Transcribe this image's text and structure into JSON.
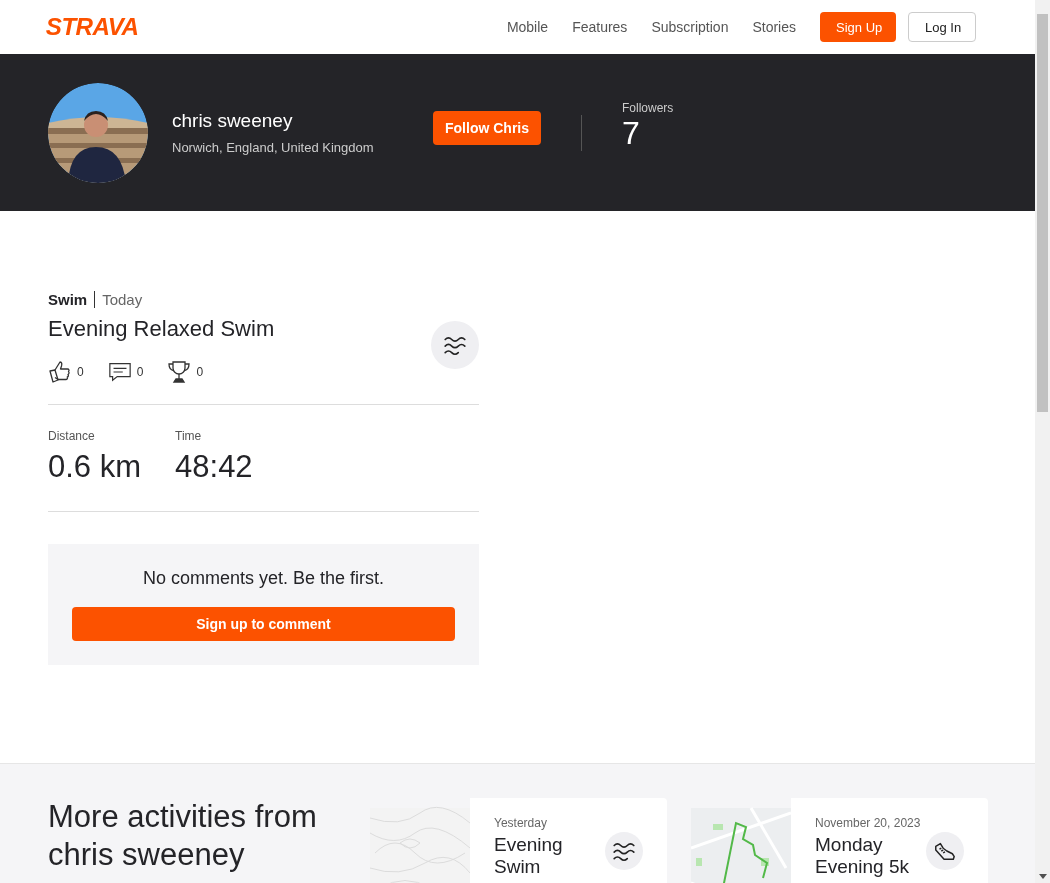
{
  "header": {
    "logo": "STRAVA",
    "nav": [
      {
        "label": "Mobile"
      },
      {
        "label": "Features"
      },
      {
        "label": "Subscription"
      },
      {
        "label": "Stories"
      }
    ],
    "buttons": [
      {
        "label": "Sign Up",
        "kind": "primary"
      },
      {
        "label": "Log In",
        "kind": "secondary"
      }
    ]
  },
  "profile": {
    "name": "chris sweeney",
    "location": "Norwich, England, United Kingdom",
    "follow_button": "Follow Chris",
    "followers_label": "Followers",
    "followers_count": "7"
  },
  "activity": {
    "sport": "Swim",
    "date": "Today",
    "title": "Evening Relaxed Swim",
    "kind": "swim",
    "reactions": [
      {
        "kind": "kudos",
        "count": "0"
      },
      {
        "kind": "comments",
        "count": "0"
      },
      {
        "kind": "achievements",
        "count": "0"
      }
    ],
    "stats": [
      {
        "label": "Distance",
        "value": "0.6 km"
      },
      {
        "label": "Time",
        "value": "48:42"
      }
    ],
    "comments": {
      "message": "No comments yet. Be the first.",
      "button": "Sign up to comment"
    }
  },
  "more_activities": {
    "heading": "More activities from chris sweeney",
    "cards": [
      {
        "kind": "swim",
        "date": "Yesterday",
        "title": "Evening Swim"
      },
      {
        "kind": "run",
        "date": "November 20, 2023",
        "title": "Monday Evening 5k"
      }
    ]
  }
}
